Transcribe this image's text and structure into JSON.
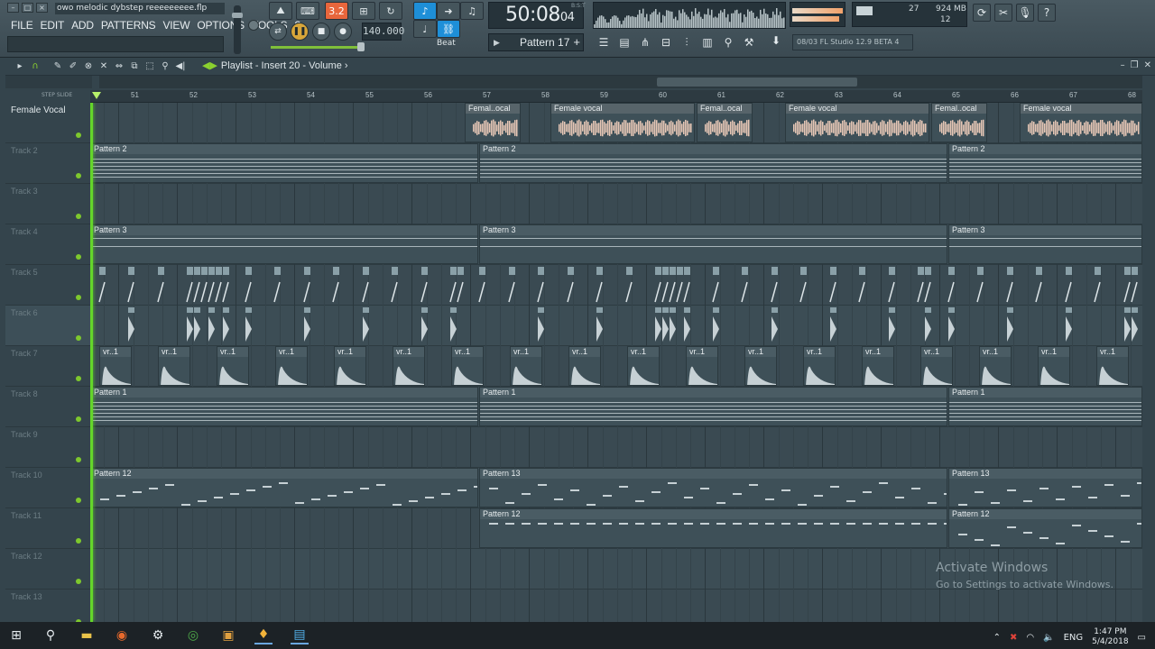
{
  "window": {
    "file_title": "owo melodic dybstep reeeeeeeee.flp"
  },
  "menu": [
    "FILE",
    "EDIT",
    "ADD",
    "PATTERNS",
    "VIEW",
    "OPTIONS",
    "TOOLS",
    "?"
  ],
  "transport": {
    "tempo": "140.000",
    "time": "50:08",
    "time_small": "04",
    "time_unit_label": "B:S:T",
    "pattern": "Pattern 17",
    "pattern_plus": "+",
    "snap_label": "Beat",
    "mode_label": "3.2"
  },
  "monitor": {
    "cpu": "27",
    "memory": "924 MB",
    "polyphony": "12"
  },
  "hint_panel": {
    "text": "08/03  FL Studio 12.9 BETA 4"
  },
  "playlist": {
    "title": "Playlist - Insert 20 - Volume",
    "title_arrow": "›",
    "step_label": "STEP",
    "slide_label": "SLIDE",
    "bars": [
      "51",
      "52",
      "53",
      "54",
      "55",
      "56",
      "57",
      "58",
      "59",
      "60",
      "61",
      "62",
      "63",
      "64",
      "65",
      "66",
      "67",
      "68"
    ],
    "tracks": [
      {
        "name": "Female Vocal",
        "bright": true
      },
      {
        "name": "Track 2"
      },
      {
        "name": "Track 3"
      },
      {
        "name": "Track 4"
      },
      {
        "name": "Track 5"
      },
      {
        "name": "Track 6",
        "selected": true
      },
      {
        "name": "Track 7"
      },
      {
        "name": "Track 8"
      },
      {
        "name": "Track 9"
      },
      {
        "name": "Track 10"
      },
      {
        "name": "Track 11"
      },
      {
        "name": "Track 12"
      },
      {
        "name": "Track 13"
      }
    ],
    "clip_labels": {
      "female_vocal_short": "Femal..ocal",
      "female_vocal": "Female vocal",
      "pattern_1": "Pattern 1",
      "pattern_2": "Pattern 2",
      "pattern_3": "Pattern 3",
      "pattern_12": "Pattern 12",
      "pattern_13": "Pattern 13",
      "vr": "vr..1"
    }
  },
  "watermark": {
    "line1": "Activate Windows",
    "line2": "Go to Settings to activate Windows."
  },
  "taskbar": {
    "lang": "ENG",
    "time": "1:47 PM",
    "date": "5/4/2018"
  },
  "colors": {
    "accent_green": "#64d62a",
    "audio_clip": "#e7c7b6",
    "orange_button": "#e8663c",
    "blue_button": "#1e8fd8"
  }
}
